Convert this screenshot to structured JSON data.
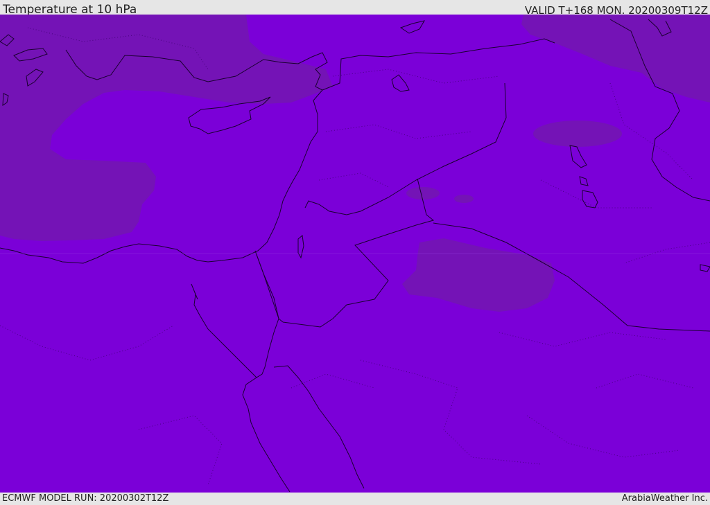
{
  "header": {
    "title": "Temperature at 10 hPa",
    "valid": "VALID T+168 MON. 20200309T12Z"
  },
  "footer": {
    "model_run": "ECMWF MODEL RUN: 20200302T12Z",
    "credit": "ArabiaWeather Inc."
  },
  "map": {
    "region": "Eastern Mediterranean and Middle East",
    "colors": {
      "field_main": "#7b00d8",
      "field_darker": "#7413b6",
      "coastline": "#1a0030",
      "background": "#e6e6e6"
    }
  }
}
